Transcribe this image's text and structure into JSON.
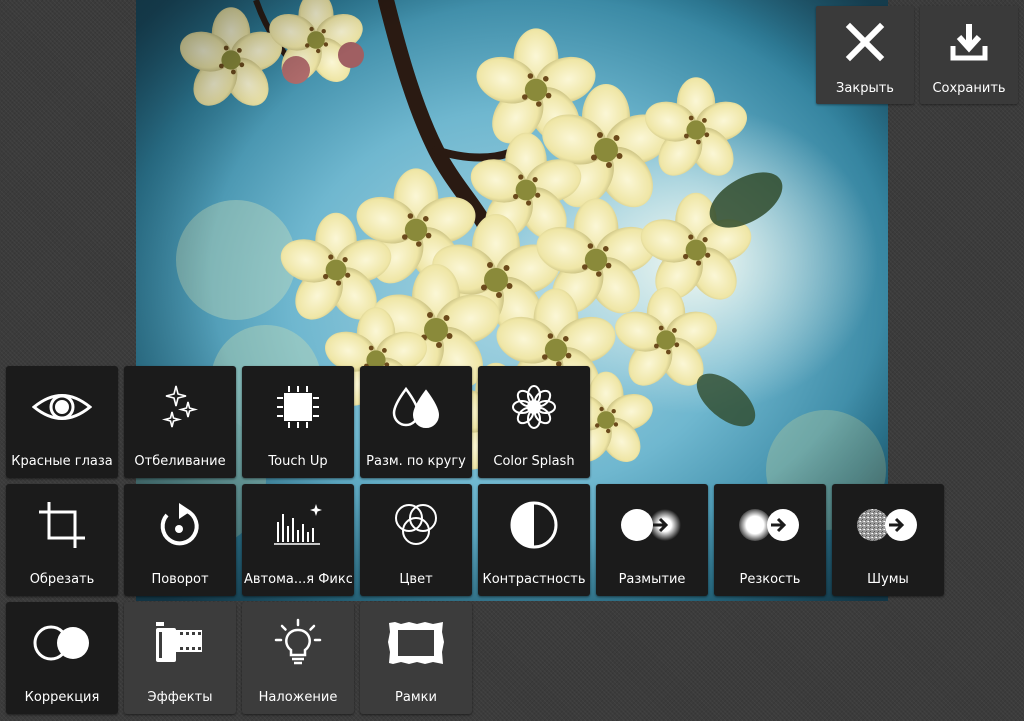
{
  "top_actions": {
    "close_label": "Закрыть",
    "save_label": "Сохранить",
    "close_icon": "close-icon",
    "save_icon": "download-icon"
  },
  "tools": {
    "row1": [
      {
        "label": "Красные глаза",
        "icon": "eye-icon"
      },
      {
        "label": "Отбеливание",
        "icon": "sparkle-icon"
      },
      {
        "label": "Touch Up",
        "icon": "patch-icon"
      },
      {
        "label": "Разм. по кругу",
        "icon": "drops-icon"
      },
      {
        "label": "Color Splash",
        "icon": "flower-icon"
      }
    ],
    "row2": [
      {
        "label": "Обрезать",
        "icon": "crop-icon"
      },
      {
        "label": "Поворот",
        "icon": "rotate-icon"
      },
      {
        "label": "Автома...я Фикс.",
        "icon": "histogram-icon"
      },
      {
        "label": "Цвет",
        "icon": "color-circles-icon"
      },
      {
        "label": "Контрастность",
        "icon": "contrast-icon"
      },
      {
        "label": "Размытие",
        "icon": "blur-icon"
      },
      {
        "label": "Резкость",
        "icon": "sharpen-icon"
      },
      {
        "label": "Шумы",
        "icon": "noise-icon"
      }
    ],
    "categories": [
      {
        "label": "Коррекция",
        "icon": "adjust-circles-icon"
      },
      {
        "label": "Эффекты",
        "icon": "film-icon"
      },
      {
        "label": "Наложение",
        "icon": "lightbulb-icon"
      },
      {
        "label": "Рамки",
        "icon": "frame-icon"
      }
    ]
  },
  "colors": {
    "tool_bg": "#1b1b1b",
    "category_bg": "#3c3c3c",
    "top_button_bg": "#3a3a3a",
    "text": "#ffffff"
  }
}
